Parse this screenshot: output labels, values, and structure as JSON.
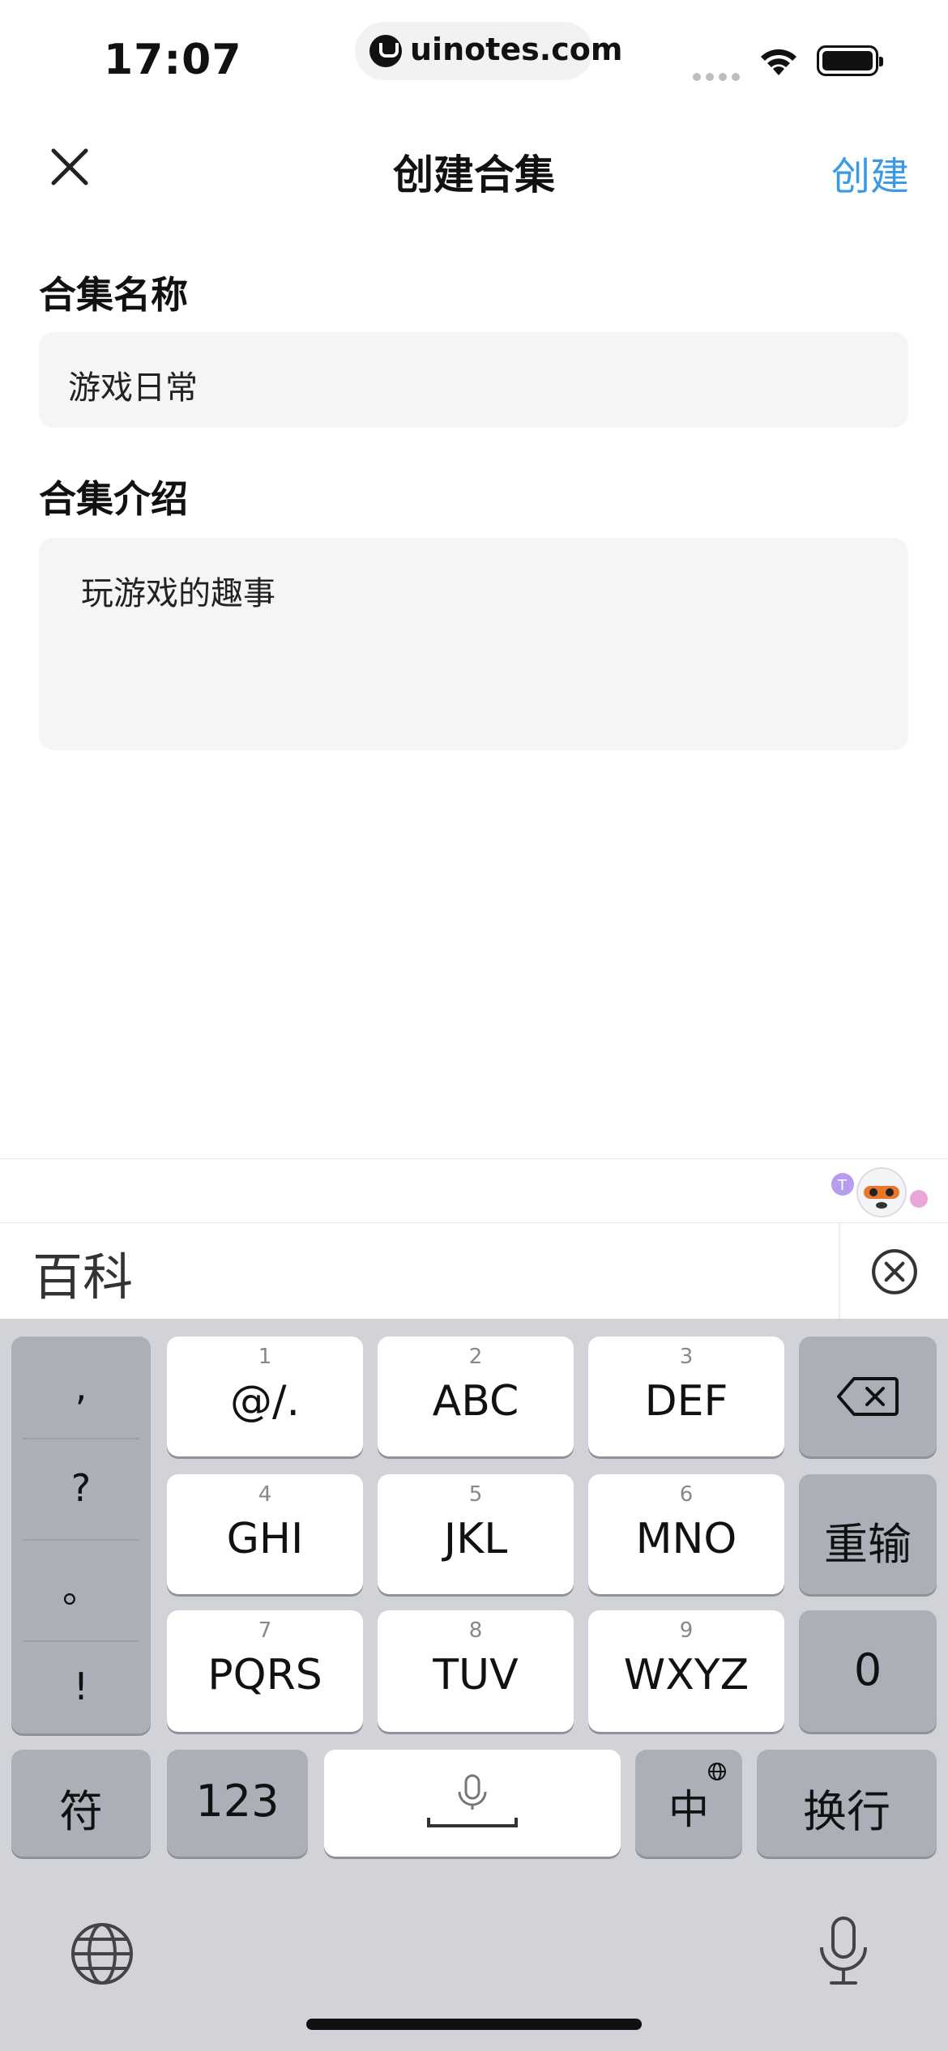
{
  "status": {
    "time": "17:07",
    "url": "uinotes.com"
  },
  "nav": {
    "title": "创建合集",
    "create_label": "创建"
  },
  "form": {
    "name_label": "合集名称",
    "name_value": "游戏日常",
    "intro_label": "合集介绍",
    "intro_value": "玩游戏的趣事"
  },
  "candidates": {
    "first": "百科"
  },
  "keyboard": {
    "punct": [
      ",",
      "?",
      "。",
      "!"
    ],
    "keys": [
      {
        "num": "1",
        "letters": "@/."
      },
      {
        "num": "2",
        "letters": "ABC"
      },
      {
        "num": "3",
        "letters": "DEF"
      },
      {
        "num": "4",
        "letters": "GHI"
      },
      {
        "num": "5",
        "letters": "JKL"
      },
      {
        "num": "6",
        "letters": "MNO"
      },
      {
        "num": "7",
        "letters": "PQRS"
      },
      {
        "num": "8",
        "letters": "TUV"
      },
      {
        "num": "9",
        "letters": "WXYZ"
      }
    ],
    "reset": "重输",
    "zero": "0",
    "symbols": "符",
    "numbers": "123",
    "lang": "中",
    "enter": "换行"
  },
  "colors": {
    "accent": "#3b9ae6",
    "field_bg": "#f5f5f5",
    "keyboard_bg": "#d1d3d9"
  }
}
